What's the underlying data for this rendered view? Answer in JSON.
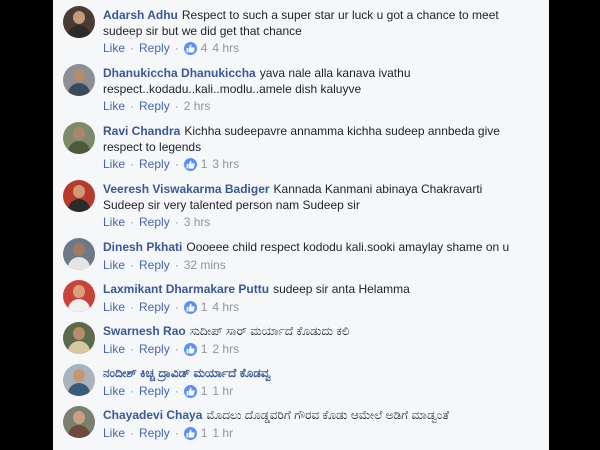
{
  "labels": {
    "like": "Like",
    "reply": "Reply"
  },
  "icons": {
    "reaction": "thumbs-up-icon",
    "avatar": "user-avatar"
  },
  "colors": {
    "author": "#385898",
    "link": "#4267b2",
    "like_badge": "#5890ff",
    "meta": "#90949c",
    "panel_bg": "#f6f7f9"
  },
  "comments": [
    {
      "author": "Adarsh Adhu",
      "text": "Respect to such a super star ur luck u got a chance to meet sudeep sir but we did get that chance",
      "likes": "4",
      "time": "4 hrs",
      "avatar_bg": "#4a3b35",
      "skin": "#c79a7a",
      "shirt": "#2e2a28"
    },
    {
      "author": "Dhanukiccha Dhanukiccha",
      "text": "yava nale alla kanava ivathu respect..kodadu..kali..modlu..amele dish kaluyve",
      "likes": "",
      "time": "2 hrs",
      "avatar_bg": "#8b8f96",
      "skin": "#b58b6e",
      "shirt": "#3c4a5e"
    },
    {
      "author": "Ravi Chandra",
      "text": "Kichha sudeepavre annamma kichha sudeep annbeda give respect to legends",
      "likes": "1",
      "time": "3 hrs",
      "avatar_bg": "#7d8a6c",
      "skin": "#a9876c",
      "shirt": "#4d5a3d"
    },
    {
      "author": "Veeresh Viswakarma Badiger",
      "text": "Kannada Kanmani abinaya Chakravarti Sudeep sir very talented person nam Sudeep sir",
      "likes": "",
      "time": "3 hrs",
      "avatar_bg": "#b63b2f",
      "skin": "#d29a72",
      "shirt": "#2b2b2b"
    },
    {
      "author": "Dinesh Pkhati",
      "text": "Oooeee child respect kododu kali.sooki amaylay shame on u",
      "likes": "",
      "time": "32 mins",
      "avatar_bg": "#6e7886",
      "skin": "#9e7b63",
      "shirt": "#e5e5e5"
    },
    {
      "author": "Laxmikant Dharmakare Puttu",
      "text": "sudeep sir anta Helamma",
      "likes": "1",
      "time": "4 hrs",
      "avatar_bg": "#c8433a",
      "skin": "#d9a27f",
      "shirt": "#f1f1f1"
    },
    {
      "author": "Swarnesh Rao",
      "text": "ಸುದೀಪ್ ಸಾರ್ ಮರ್ಯಾದೆ ಕೊಡುದು ಕಲಿ",
      "likes": "1",
      "time": "2 hrs",
      "avatar_bg": "#5c6b4a",
      "skin": "#b78c6a",
      "shirt": "#d6c9a0"
    },
    {
      "author": "ನಂದೀಶ್ ಕಿಚ್ಚ ದ್ರಾವಿಡ್ ಮರ್ಯಾದೆ ಕೊಡವ್ವ",
      "text": "",
      "likes": "1",
      "time": "1 hr",
      "avatar_bg": "#a7b3bd",
      "skin": "#c59675",
      "shirt": "#3a5a7a"
    },
    {
      "author": "Chayadevi Chaya",
      "text": "ಮೊದಲು ದೊಡ್ಡವರಿಗೆ ಗೌರವ ಕೊಡು ಆಮೇಲೆ ಅಡಿಗೆ ಮಾಡ್ವಂತೆ",
      "likes": "1",
      "time": "1 hr",
      "avatar_bg": "#7a7f70",
      "skin": "#c8a081",
      "shirt": "#6d4a3a"
    }
  ]
}
